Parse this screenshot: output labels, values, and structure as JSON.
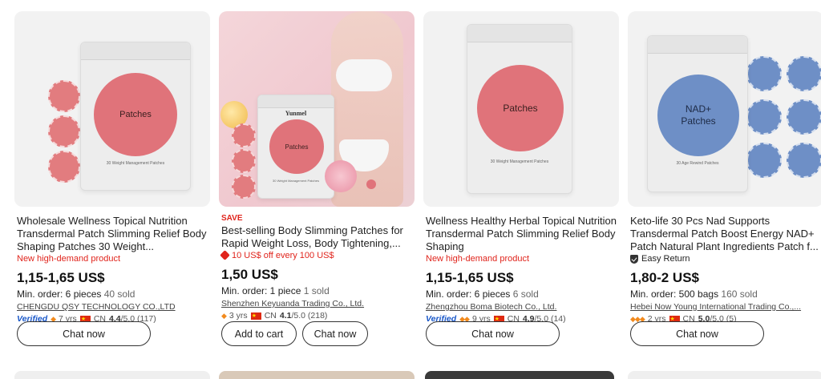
{
  "products": [
    {
      "image_label": "Patches",
      "image_sublabel": "30 Weight Management Patches",
      "save_tag": "",
      "title": "Wholesale Wellness Topical Nutrition Transdermal Patch Slimming Relief Body Shaping Patches 30 Weight...",
      "tag": "New high-demand product",
      "price": "1,15-1,65 US$",
      "min_order": "Min. order: 6 pieces",
      "sold": "40 sold",
      "supplier": "CHENGDU QSY TECHNOLOGY CO.,LTD",
      "verified": "Verified",
      "years": "7 yrs",
      "country": "CN",
      "rating": "4.4",
      "rating_suffix": "/5.0 (117)",
      "buttons": [
        "Chat now"
      ]
    },
    {
      "image_label": "Patches",
      "image_brand": "Yunmel",
      "image_sublabel": "30 Weight Management Patches",
      "save_tag": "SAVE",
      "title": "Best-selling Body Slimming Patches for Rapid Weight Loss, Body Tightening,...",
      "tag": "10 US$ off every 100 US$",
      "price": "1,50 US$",
      "min_order": "Min. order: 1 piece",
      "sold": "1 sold",
      "supplier": "Shenzhen Keyuanda Trading Co., Ltd.",
      "verified": "",
      "years": "3 yrs",
      "country": "CN",
      "rating": "4.1",
      "rating_suffix": "/5.0 (218)",
      "buttons": [
        "Add to cart",
        "Chat now"
      ]
    },
    {
      "image_label": "Patches",
      "image_sublabel": "30 Weight Management Patches",
      "save_tag": "",
      "title": "Wellness Healthy Herbal Topical Nutrition Transdermal Patch Slimming Relief Body Shaping",
      "tag": "New high-demand product",
      "price": "1,15-1,65 US$",
      "min_order": "Min. order: 6 pieces",
      "sold": "6 sold",
      "supplier": "Zhengzhou Boma Biotech Co., Ltd.",
      "verified": "Verified",
      "years": "9 yrs",
      "country": "CN",
      "rating": "4.9",
      "rating_suffix": "/5.0 (14)",
      "buttons": [
        "Chat now"
      ]
    },
    {
      "image_label": "NAD+ Patches",
      "image_sublabel": "30 Age Rewind Patches",
      "save_tag": "",
      "title": "Keto-life 30 Pcs Nad Supports Transdermal Patch Boost Energy NAD+ Patch Natural Plant Ingredients Patch f...",
      "tag": "Easy Return",
      "price": "1,80-2 US$",
      "min_order": "Min. order: 500 bags",
      "sold": "160 sold",
      "supplier": "Hebei Now Young International Trading Co.,...",
      "verified": "",
      "years": "2 yrs",
      "country": "CN",
      "rating": "5.0",
      "rating_suffix": "/5.0 (5)",
      "buttons": [
        "Chat now"
      ]
    }
  ],
  "colors": {
    "accent_red": "#e0241c",
    "verified_blue": "#1a58c9",
    "diamond_orange": "#f28a1d",
    "patch_pink": "#e0737a",
    "patch_blue": "#6e8fc6"
  }
}
